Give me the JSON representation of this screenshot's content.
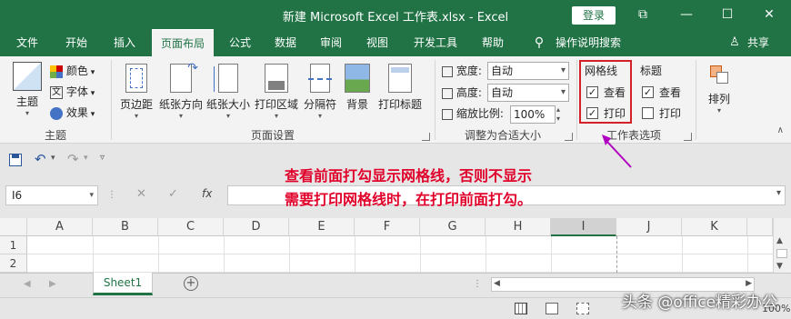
{
  "window": {
    "title": "新建 Microsoft Excel 工作表.xlsx  -  Excel",
    "login_label": "登录",
    "controls": [
      "⧉",
      "—",
      "☐",
      "✕"
    ]
  },
  "tabs": [
    {
      "label": "文件"
    },
    {
      "label": "开始"
    },
    {
      "label": "插入"
    },
    {
      "label": "页面布局"
    },
    {
      "label": "公式"
    },
    {
      "label": "数据"
    },
    {
      "label": "审阅"
    },
    {
      "label": "视图"
    },
    {
      "label": "开发工具"
    },
    {
      "label": "帮助"
    },
    {
      "label": "操作说明搜索"
    },
    {
      "label": "共享"
    }
  ],
  "ribbon": {
    "themes": {
      "main_label": "主题",
      "colors": "颜色",
      "fonts": "字体",
      "effects": "效果",
      "group_label": "主题"
    },
    "page_setup": {
      "buttons": [
        "页边距",
        "纸张方向",
        "纸张大小",
        "打印区域",
        "分隔符",
        "背景",
        "打印标题"
      ],
      "group_label": "页面设置"
    },
    "scale": {
      "width_label": "宽度:",
      "width_value": "自动",
      "height_label": "高度:",
      "height_value": "自动",
      "scale_label": "缩放比例:",
      "scale_value": "100%",
      "group_label": "调整为合适大小"
    },
    "sheet_options": {
      "gridlines_label": "网格线",
      "gridlines_view": "查看",
      "gridlines_print": "打印",
      "headings_label": "标题",
      "headings_view": "查看",
      "headings_print": "打印",
      "group_label": "工作表选项",
      "gridlines_view_checked": true,
      "gridlines_print_checked": true,
      "headings_view_checked": true,
      "headings_print_checked": false
    },
    "arrange": {
      "label": "排列"
    }
  },
  "annotation": {
    "line1": "查看前面打勾显示网格线，否则不显示",
    "line2": "需要打印网格线时，在打印前面打勾。",
    "color": "#e0002a"
  },
  "formula_bar": {
    "name_box": "I6",
    "fx": "fx"
  },
  "columns": [
    "A",
    "B",
    "C",
    "D",
    "E",
    "F",
    "G",
    "H",
    "I",
    "J",
    "K"
  ],
  "rows": [
    "1",
    "2"
  ],
  "sheets": [
    {
      "label": "Sheet1"
    }
  ],
  "status": {
    "zoom": "100%"
  },
  "watermark": "头条 @office精彩办公"
}
